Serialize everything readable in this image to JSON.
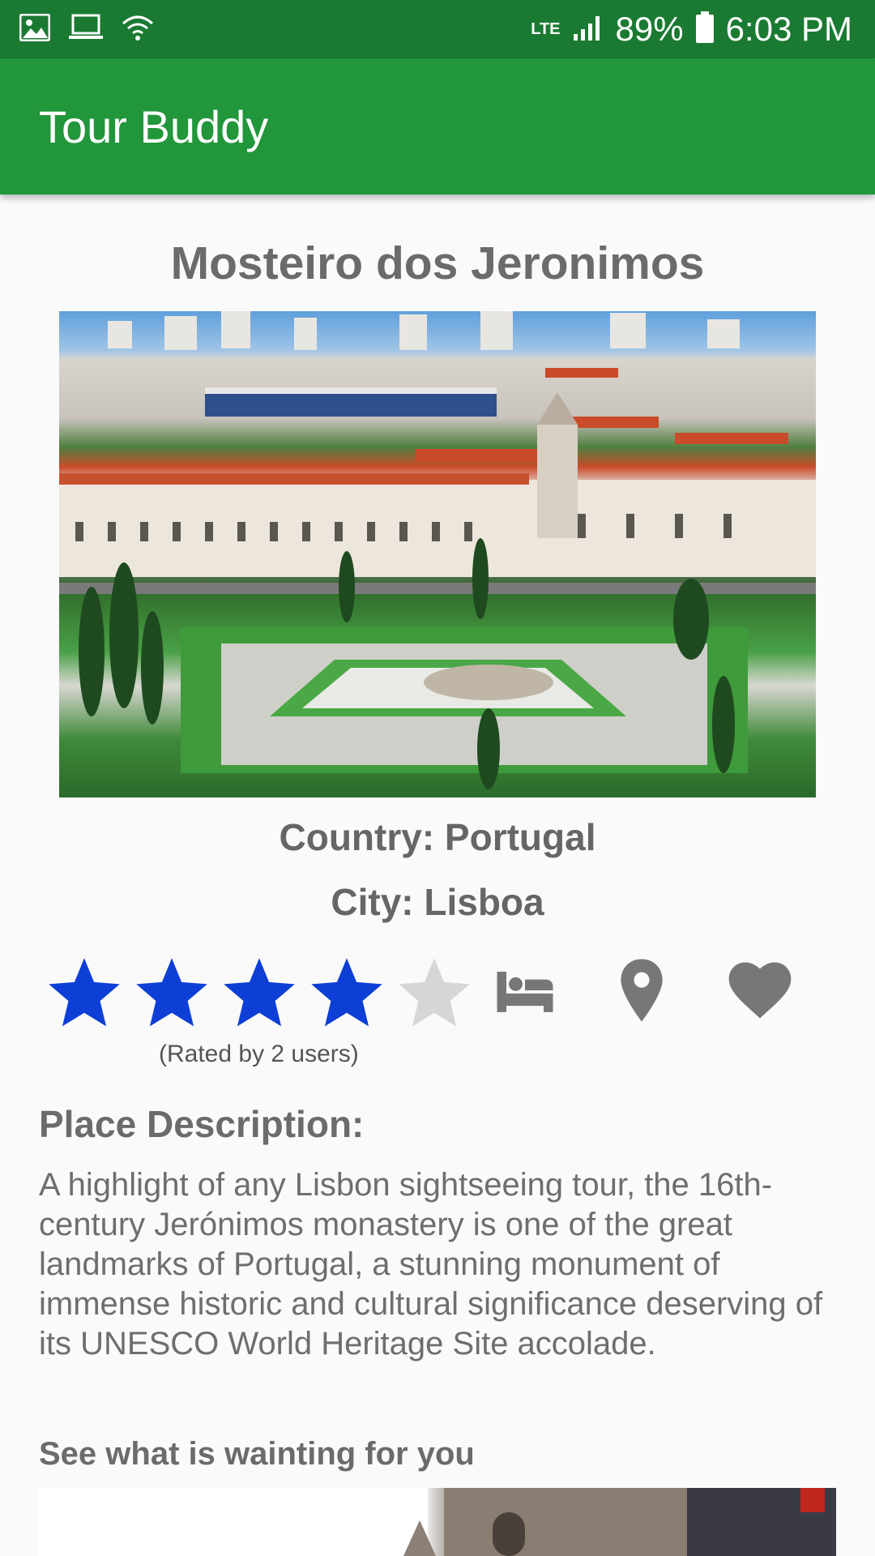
{
  "status_bar": {
    "network": "LTE",
    "battery": "89%",
    "time": "6:03 PM",
    "icons": [
      "image-icon",
      "laptop-icon",
      "wifi-icon",
      "signal-icon",
      "battery-icon"
    ]
  },
  "app_bar": {
    "title": "Tour Buddy"
  },
  "place": {
    "title": "Mosteiro dos Jeronimos",
    "photo_icon": "monastery-photo",
    "country_line": "Country: Portugal",
    "city_line": "City: Lisboa"
  },
  "rating": {
    "value": 4,
    "max": 5,
    "filled_color": "#0d3fd6",
    "empty_color": "#d6d6d6",
    "rated_by": "(Rated by 2 users)"
  },
  "actions": {
    "icons": [
      "hotel-bed-icon",
      "location-pin-icon",
      "favorite-heart-icon"
    ],
    "color": "#777777"
  },
  "description": {
    "label": "Place Description:",
    "text": "A highlight of any Lisbon sightseeing tour, the 16th-century Jerónimos monastery is one of the great landmarks of Portugal, a stunning monument of immense historic and cultural significance deserving of its UNESCO World Heritage Site accolade."
  },
  "gallery": {
    "label": "See what is wainting for you"
  },
  "colors": {
    "status_bar": "#1a7a32",
    "app_bar": "#22963a",
    "text_gray": "#6b6b6b"
  }
}
